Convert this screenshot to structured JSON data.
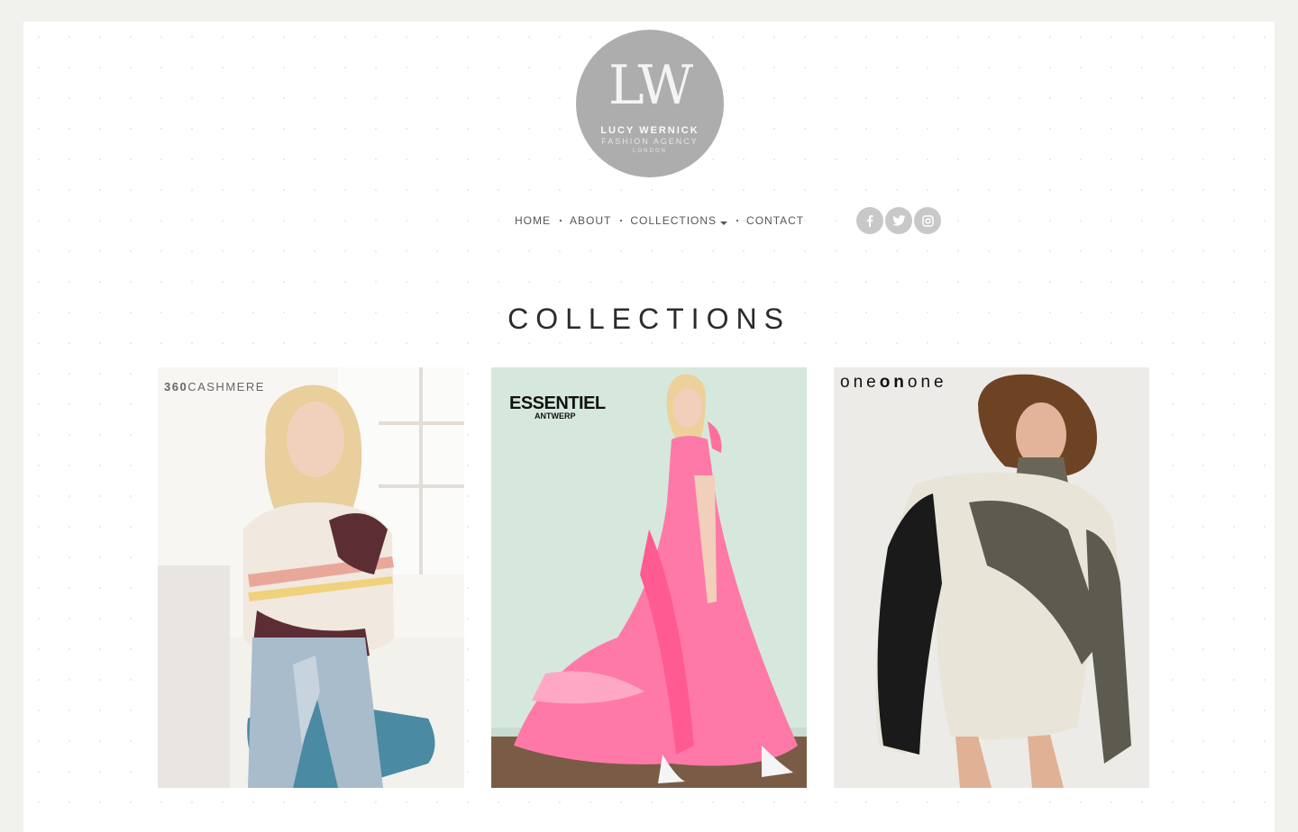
{
  "logo": {
    "monogram": "LW",
    "line1": "LUCY WERNICK",
    "line2": "FASHION AGENCY",
    "line3": "LONDON"
  },
  "nav": {
    "items": [
      {
        "label": "HOME"
      },
      {
        "label": "ABOUT"
      },
      {
        "label": "COLLECTIONS"
      },
      {
        "label": "CONTACT"
      }
    ]
  },
  "social": [
    "facebook-icon",
    "twitter-icon",
    "instagram-icon"
  ],
  "page_title": "COLLECTIONS",
  "collections": [
    {
      "brand": "360CASHMERE",
      "brand_a": "360",
      "brand_b": "CASHMERE"
    },
    {
      "brand_main": "ESSENTIEL",
      "brand_sub": "ANTWERP"
    },
    {
      "brand_a": "one",
      "brand_b": "on",
      "brand_c": "one"
    }
  ],
  "colors": {
    "background": "#f1f2ee",
    "logo_circle": "#adadad",
    "nav_text": "#555555",
    "social_circle": "#c8c8c8",
    "title_text": "#2b2b2b"
  }
}
